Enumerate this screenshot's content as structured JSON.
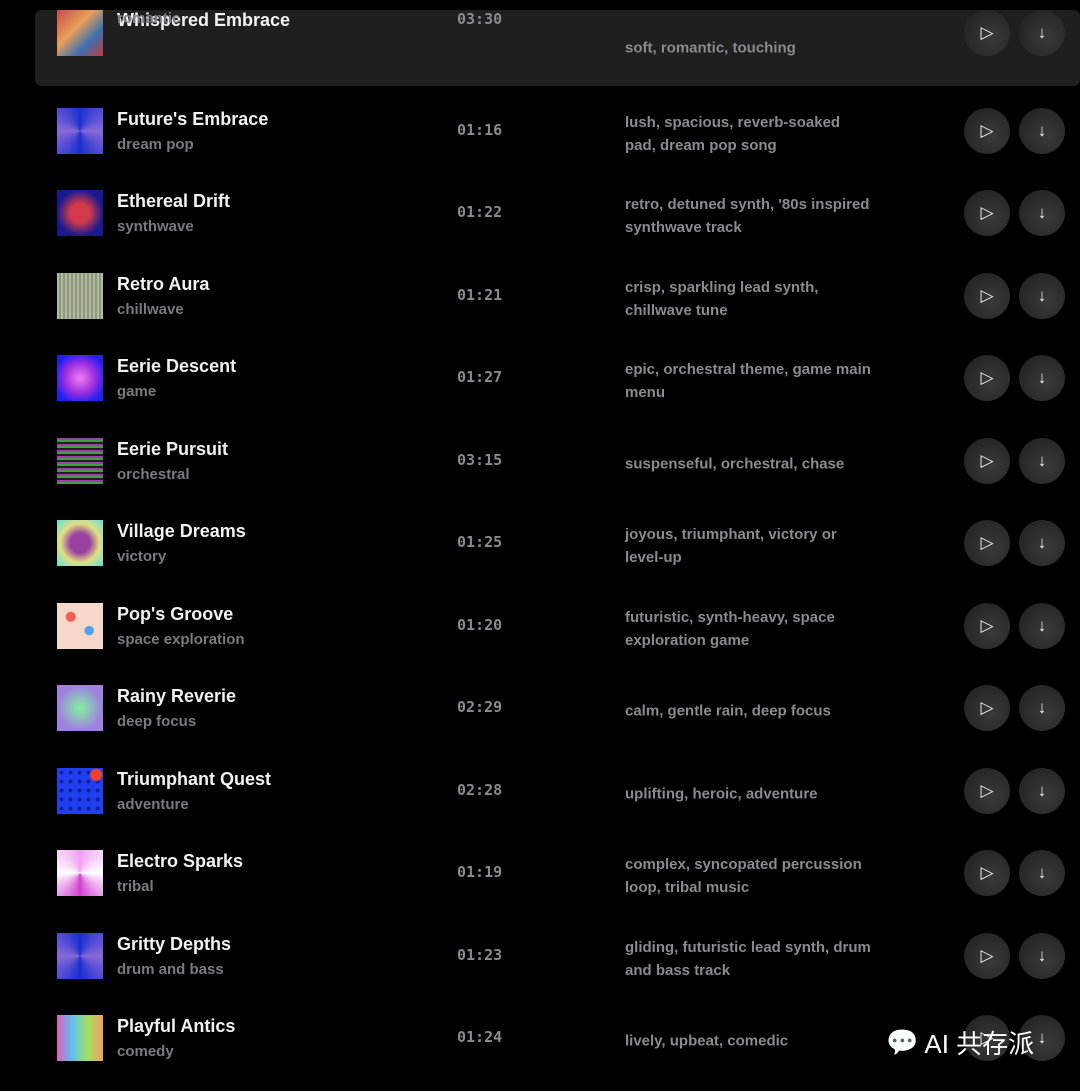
{
  "tracks": [
    {
      "title": "Whispered Embrace",
      "genre": "romantic",
      "duration": "03:30",
      "description": "soft, romantic, touching",
      "thumb": "linear-gradient(135deg,#c94a4a,#e8a05a 40%,#3b6fb0 70%,#c43c3c)",
      "active": true
    },
    {
      "title": "Future's Embrace",
      "genre": "dream pop",
      "duration": "01:16",
      "description": "lush, spacious, reverb-soaked pad, dream pop song",
      "thumb": "conic-gradient(#1a2fd0,#8a6ad8,#1a2fd0,#8a6ad8,#1a2fd0)"
    },
    {
      "title": "Ethereal Drift",
      "genre": "synthwave",
      "duration": "01:22",
      "description": "retro, detuned synth, '80s inspired synthwave track",
      "thumb": "radial-gradient(circle,#d23a4a 30%,#1a1a90 70%)"
    },
    {
      "title": "Retro Aura",
      "genre": "chillwave",
      "duration": "01:21",
      "description": "crisp, sparkling lead synth, chillwave tune",
      "thumb": "repeating-linear-gradient(90deg,#b8b8a0 0 2px,#8a9a80 2px 4px)"
    },
    {
      "title": "Eerie Descent",
      "genre": "game",
      "duration": "01:27",
      "description": "epic, orchestral theme, game main menu",
      "thumb": "radial-gradient(circle,#f080f0,#a030e0 45%,#2020f0 80%)"
    },
    {
      "title": "Eerie Pursuit",
      "genre": "orchestral",
      "duration": "03:15",
      "description": "suspenseful, orchestral, chase",
      "thumb": "repeating-linear-gradient(0deg,#40a040 0 2px,#a040b0 2px 4px,#202020 4px 6px)"
    },
    {
      "title": "Village Dreams",
      "genre": "victory",
      "duration": "01:25",
      "description": "joyous, triumphant, victory or level-up",
      "thumb": "radial-gradient(circle,#9a40a0 30%,#e0e080 60%,#60e0e0)"
    },
    {
      "title": "Pop's Groove",
      "genre": "space exploration",
      "duration": "01:20",
      "description": "futuristic, synth-heavy, space exploration game",
      "thumb": "radial-gradient(circle at 30% 30%,#f06050 10%,transparent 12%),radial-gradient(circle at 70% 60%,#50a0f0 10%,transparent 12%),#f5d8c8"
    },
    {
      "title": "Rainy Reverie",
      "genre": "deep focus",
      "duration": "02:29",
      "description": "calm, gentle rain, deep focus",
      "thumb": "radial-gradient(circle,#80f0a0,#a080e0 70%)"
    },
    {
      "title": "Triumphant Quest",
      "genre": "adventure",
      "duration": "02:28",
      "description": "uplifting, heroic, adventure",
      "thumb": "radial-gradient(circle at 85% 15%,#f04030 10%,transparent 12%),radial-gradient(circle,#1020a0 30%,#2040f0 32%) 0 0/9px 9px"
    },
    {
      "title": "Electro Sparks",
      "genre": "tribal",
      "duration": "01:19",
      "description": "complex, syncopated percussion loop, tribal music",
      "thumb": "conic-gradient(#f0a0f0,#fff,#d040d0,#fff,#f0a0f0)"
    },
    {
      "title": "Gritty Depths",
      "genre": "drum and bass",
      "duration": "01:23",
      "description": "gliding, futuristic lead synth, drum and bass track",
      "thumb": "conic-gradient(#1a2fd0,#8a6ad8,#1a2fd0,#8a6ad8,#1a2fd0)"
    },
    {
      "title": "Playful Antics",
      "genre": "comedy",
      "duration": "01:24",
      "description": "lively, upbeat, comedic",
      "thumb": "linear-gradient(90deg,#e060c0,#60c0f0,#a0e060,#f0a060)"
    }
  ],
  "icons": {
    "play": "play-icon",
    "download": "download-icon"
  },
  "watermark": "AI 共存派"
}
